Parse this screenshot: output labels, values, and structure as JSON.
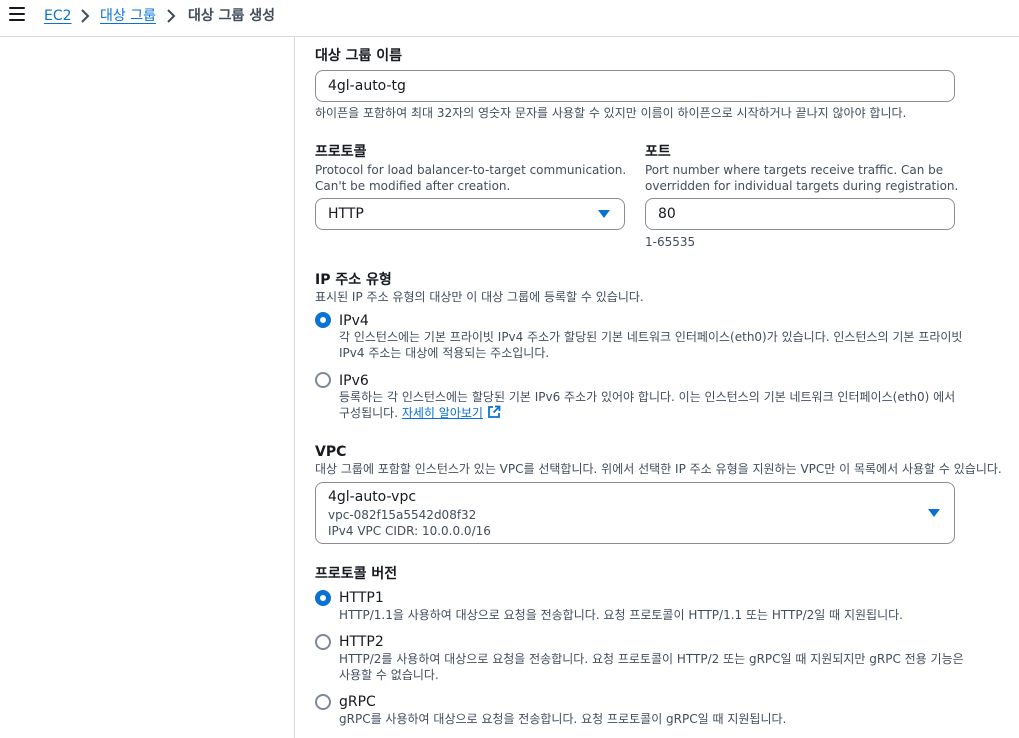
{
  "breadcrumb": {
    "ec2": "EC2",
    "target_groups": "대상 그룹",
    "current": "대상 그룹 생성"
  },
  "target_group_name": {
    "label": "대상 그룹 이름",
    "value": "4gl-auto-tg",
    "hint": "하이픈을 포함하여 최대 32자의 영숫자 문자를 사용할 수 있지만 이름이 하이픈으로 시작하거나 끝나지 않아야 합니다."
  },
  "protocol": {
    "label": "프로토콜",
    "desc_line1": "Protocol for load balancer-to-target communication.",
    "desc_line2": "Can't be modified after creation.",
    "value": "HTTP"
  },
  "port": {
    "label": "포트",
    "desc_line1": "Port number where targets receive traffic. Can be",
    "desc_line2": "overridden for individual targets during registration.",
    "value": "80",
    "range": "1-65535"
  },
  "ip_type": {
    "label": "IP 주소 유형",
    "desc": "표시된 IP 주소 유형의 대상만 이 대상 그룹에 등록할 수 있습니다.",
    "ipv4": {
      "title": "IPv4",
      "line1": "각 인스턴스에는 기본 프라이빗 IPv4 주소가 할당된 기본 네트워크 인터페이스(eth0)가 있습니다. 인스턴스의 기본 프라이빗",
      "line2": "IPv4 주소는 대상에 적용되는 주소입니다.",
      "selected": true
    },
    "ipv6": {
      "title": "IPv6",
      "line1": "등록하는 각 인스턴스에는 할당된 기본 IPv6 주소가 있어야 합니다. 이는 인스턴스의 기본 네트워크 인터페이스(eth0) 에서",
      "line2": "구성됩니다.",
      "link": "자세히 알아보기",
      "selected": false
    }
  },
  "vpc": {
    "label": "VPC",
    "desc": "대상 그룹에 포함할 인스턴스가 있는 VPC를 선택합니다. 위에서 선택한 IP 주소 유형을 지원하는 VPC만 이 목록에서 사용할 수 있습니다.",
    "name": "4gl-auto-vpc",
    "id": "vpc-082f15a5542d08f32",
    "cidr": "IPv4 VPC CIDR: 10.0.0.0/16"
  },
  "protocol_version": {
    "label": "프로토콜 버전",
    "http1": {
      "title": "HTTP1",
      "line1": "HTTP/1.1을 사용하여 대상으로 요청을 전송합니다. 요청 프로토콜이 HTTP/1.1 또는 HTTP/2일 때 지원됩니다.",
      "selected": true
    },
    "http2": {
      "title": "HTTP2",
      "line1": "HTTP/2를 사용하여 대상으로 요청을 전송합니다. 요청 프로토콜이 HTTP/2 또는 gRPC일 때 지원되지만 gRPC 전용 기능은",
      "line2": "사용할 수 없습니다.",
      "selected": false
    },
    "grpc": {
      "title": "gRPC",
      "line1": "gRPC를 사용하여 대상으로 요청을 전송합니다. 요청 프로토콜이 gRPC일 때 지원됩니다.",
      "selected": false
    }
  },
  "colors": {
    "accent": "#0972d3",
    "text": "#16191f",
    "muted": "#414d5c",
    "border": "#8c8c94"
  }
}
